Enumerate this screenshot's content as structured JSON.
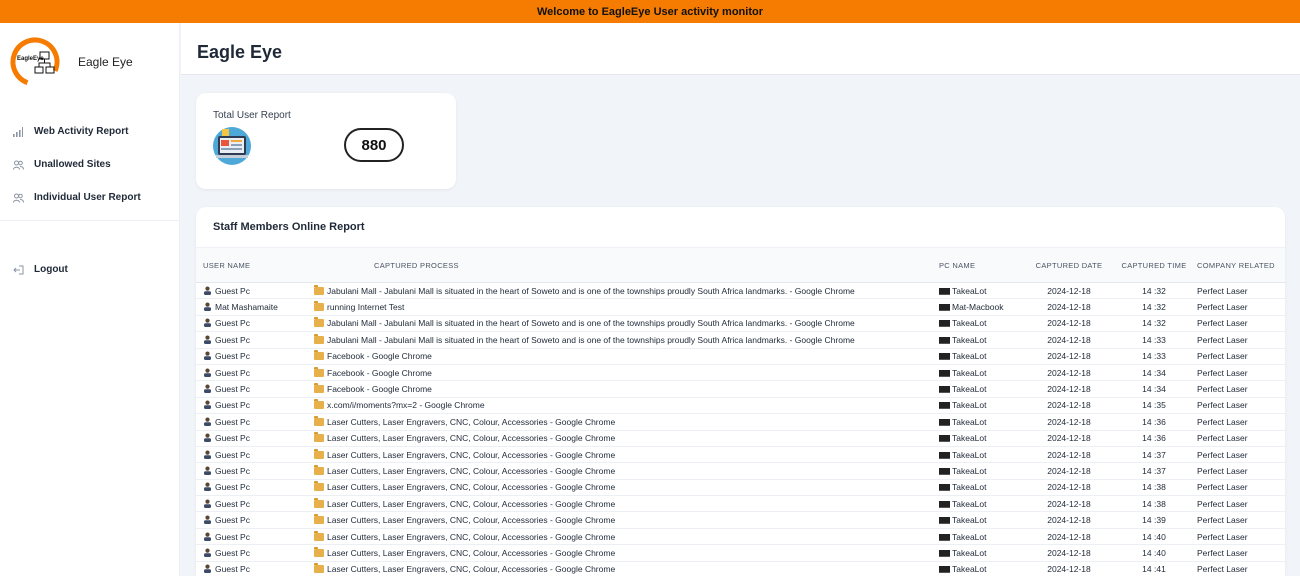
{
  "banner": {
    "text": "Welcome to EagleEye User activity monitor"
  },
  "brand": {
    "name": "Eagle Eye",
    "logo_text": "EagleEye"
  },
  "sidebar": {
    "items": [
      {
        "label": "Web Activity Report",
        "icon": "bar-chart-icon"
      },
      {
        "label": "Unallowed Sites",
        "icon": "users-icon"
      },
      {
        "label": "Individual User Report",
        "icon": "users-icon"
      }
    ],
    "logout": {
      "label": "Logout",
      "icon": "logout-icon"
    }
  },
  "header": {
    "title": "Eagle Eye"
  },
  "summary": {
    "title": "Total User Report",
    "count": "880"
  },
  "report": {
    "title": "Staff Members Online Report",
    "columns": [
      "USER NAME",
      "CAPTURED PROCESS",
      "PC NAME",
      "CAPTURED DATE",
      "CAPTURED TIME",
      "COMPANY RELATED"
    ],
    "rows": [
      {
        "user": "Guest Pc",
        "process": "Jabulani Mall - Jabulani Mall is situated in the heart of Soweto and is one of the townships proudly South Africa landmarks. - Google Chrome",
        "pc": "TakeaLot",
        "date": "2024-12-18",
        "time": "14 :32",
        "company": "Perfect Laser"
      },
      {
        "user": "Mat Mashamaite",
        "process": "running Internet Test",
        "pc": "Mat-Macbook",
        "date": "2024-12-18",
        "time": "14 :32",
        "company": "Perfect Laser"
      },
      {
        "user": "Guest Pc",
        "process": "Jabulani Mall - Jabulani Mall is situated in the heart of Soweto and is one of the townships proudly South Africa landmarks. - Google Chrome",
        "pc": "TakeaLot",
        "date": "2024-12-18",
        "time": "14 :32",
        "company": "Perfect Laser"
      },
      {
        "user": "Guest Pc",
        "process": "Jabulani Mall - Jabulani Mall is situated in the heart of Soweto and is one of the townships proudly South Africa landmarks. - Google Chrome",
        "pc": "TakeaLot",
        "date": "2024-12-18",
        "time": "14 :33",
        "company": "Perfect Laser"
      },
      {
        "user": "Guest Pc",
        "process": "Facebook - Google Chrome",
        "pc": "TakeaLot",
        "date": "2024-12-18",
        "time": "14 :33",
        "company": "Perfect Laser"
      },
      {
        "user": "Guest Pc",
        "process": "Facebook - Google Chrome",
        "pc": "TakeaLot",
        "date": "2024-12-18",
        "time": "14 :34",
        "company": "Perfect Laser"
      },
      {
        "user": "Guest Pc",
        "process": "Facebook - Google Chrome",
        "pc": "TakeaLot",
        "date": "2024-12-18",
        "time": "14 :34",
        "company": "Perfect Laser"
      },
      {
        "user": "Guest Pc",
        "process": "x.com/i/moments?mx=2 - Google Chrome",
        "pc": "TakeaLot",
        "date": "2024-12-18",
        "time": "14 :35",
        "company": "Perfect Laser"
      },
      {
        "user": "Guest Pc",
        "process": "Laser Cutters, Laser Engravers, CNC, Colour, Accessories - Google Chrome",
        "pc": "TakeaLot",
        "date": "2024-12-18",
        "time": "14 :36",
        "company": "Perfect Laser"
      },
      {
        "user": "Guest Pc",
        "process": "Laser Cutters, Laser Engravers, CNC, Colour, Accessories - Google Chrome",
        "pc": "TakeaLot",
        "date": "2024-12-18",
        "time": "14 :36",
        "company": "Perfect Laser"
      },
      {
        "user": "Guest Pc",
        "process": "Laser Cutters, Laser Engravers, CNC, Colour, Accessories - Google Chrome",
        "pc": "TakeaLot",
        "date": "2024-12-18",
        "time": "14 :37",
        "company": "Perfect Laser"
      },
      {
        "user": "Guest Pc",
        "process": "Laser Cutters, Laser Engravers, CNC, Colour, Accessories - Google Chrome",
        "pc": "TakeaLot",
        "date": "2024-12-18",
        "time": "14 :37",
        "company": "Perfect Laser"
      },
      {
        "user": "Guest Pc",
        "process": "Laser Cutters, Laser Engravers, CNC, Colour, Accessories - Google Chrome",
        "pc": "TakeaLot",
        "date": "2024-12-18",
        "time": "14 :38",
        "company": "Perfect Laser"
      },
      {
        "user": "Guest Pc",
        "process": "Laser Cutters, Laser Engravers, CNC, Colour, Accessories - Google Chrome",
        "pc": "TakeaLot",
        "date": "2024-12-18",
        "time": "14 :38",
        "company": "Perfect Laser"
      },
      {
        "user": "Guest Pc",
        "process": "Laser Cutters, Laser Engravers, CNC, Colour, Accessories - Google Chrome",
        "pc": "TakeaLot",
        "date": "2024-12-18",
        "time": "14 :39",
        "company": "Perfect Laser"
      },
      {
        "user": "Guest Pc",
        "process": "Laser Cutters, Laser Engravers, CNC, Colour, Accessories - Google Chrome",
        "pc": "TakeaLot",
        "date": "2024-12-18",
        "time": "14 :40",
        "company": "Perfect Laser"
      },
      {
        "user": "Guest Pc",
        "process": "Laser Cutters, Laser Engravers, CNC, Colour, Accessories - Google Chrome",
        "pc": "TakeaLot",
        "date": "2024-12-18",
        "time": "14 :40",
        "company": "Perfect Laser"
      },
      {
        "user": "Guest Pc",
        "process": "Laser Cutters, Laser Engravers, CNC, Colour, Accessories - Google Chrome",
        "pc": "TakeaLot",
        "date": "2024-12-18",
        "time": "14 :41",
        "company": "Perfect Laser"
      }
    ]
  },
  "colors": {
    "banner": "#f57c00",
    "background": "#f1f4f8",
    "card": "#ffffff"
  }
}
